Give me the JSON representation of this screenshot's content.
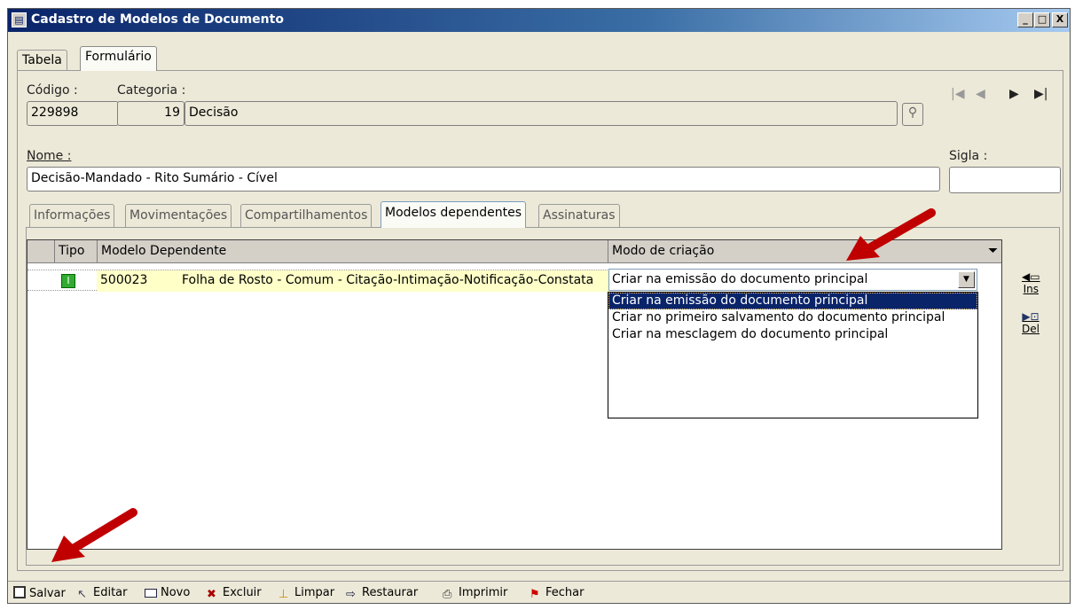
{
  "window": {
    "title": "Cadastro de Modelos de Documento",
    "buttons": [
      "_",
      "□",
      "X"
    ]
  },
  "tabs": [
    {
      "label": "Tabela",
      "active": false
    },
    {
      "label": "Formulário",
      "active": true
    }
  ],
  "form": {
    "codigo_label": "Código :",
    "codigo_value": "229898",
    "categoria_label": "Categoria :",
    "categoria_code": "19",
    "categoria_name": "Decisão",
    "nome_label": "Nome :",
    "nome_value": "Decisão-Mandado - Rito Sumário - Cível",
    "sigla_label": "Sigla :",
    "sigla_value": ""
  },
  "nav": {
    "first": "|◀",
    "prev": "◀",
    "next": "▶",
    "last": "▶|"
  },
  "inner_tabs": [
    {
      "label": "Informações",
      "active": false
    },
    {
      "label": "Movimentações",
      "active": false
    },
    {
      "label": "Compartilhamentos",
      "active": false
    },
    {
      "label": "Modelos dependentes",
      "active": true
    },
    {
      "label": "Assinaturas",
      "active": false
    }
  ],
  "grid": {
    "columns": [
      "Tipo",
      "Modelo Dependente",
      "Modo de criação"
    ],
    "rows": [
      {
        "tipo": "I",
        "codigo": "500023",
        "modelo": "Folha de Rosto - Comum - Citação-Intimação-Notificação-Constata",
        "modo": "Criar na emissão do documento principal"
      }
    ]
  },
  "dropdown": {
    "value": "Criar na emissão do documento principal",
    "options": [
      "Criar na emissão do documento principal",
      "Criar no primeiro salvamento do documento principal",
      "Criar na mesclagem do documento principal"
    ],
    "selected_index": 0
  },
  "side_buttons": {
    "ins": "Ins",
    "del": "Del"
  },
  "toolbar": {
    "salvar": "Salvar",
    "editar": "Editar",
    "novo": "Novo",
    "excluir": "Excluir",
    "limpar": "Limpar",
    "restaurar": "Restaurar",
    "imprimir": "Imprimir",
    "fechar": "Fechar"
  },
  "colors": {
    "title_bar": "#0a246a",
    "highlight": "#0a246a",
    "annotation_arrow": "#c00000"
  }
}
